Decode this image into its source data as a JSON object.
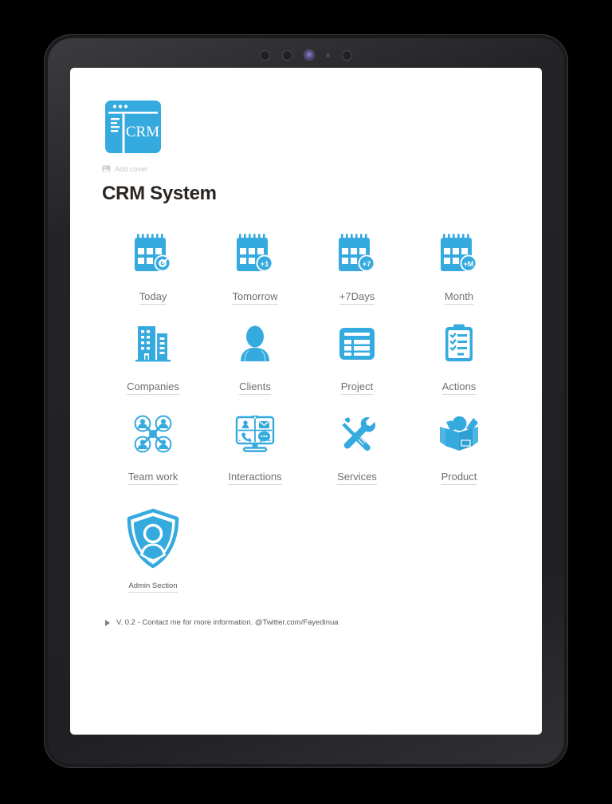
{
  "device": {
    "type": "tablet-mockup",
    "sensors": [
      "sensor-ring",
      "sensor-ring",
      "front-camera",
      "sensor-dot",
      "sensor-ring"
    ]
  },
  "theme": {
    "accent": "#35AADF",
    "accent_dark": "#2E9FD4",
    "page_bg": "#FFFFFF",
    "title_color": "#2A2520",
    "label_color": "#6F6F6F",
    "underline_color": "#D8D8D8",
    "muted_color": "#C6C6C6",
    "bezel_color": "#1B1B1D"
  },
  "header": {
    "logo_icon": "crm-browser-logo-icon",
    "logo_text": "CRM",
    "add_cover_label": "Add cover",
    "add_cover_icon": "image-icon",
    "title": "CRM System"
  },
  "grid": {
    "items": [
      {
        "label": "Today",
        "icon": "calendar-today-icon",
        "badge": "target"
      },
      {
        "label": "Tomorrow",
        "icon": "calendar-plus-one-icon",
        "badge": "+1"
      },
      {
        "label": "+7Days",
        "icon": "calendar-plus-seven-icon",
        "badge": "+7"
      },
      {
        "label": "Month",
        "icon": "calendar-month-icon",
        "badge": "+M"
      },
      {
        "label": "Companies",
        "icon": "office-building-icon",
        "badge": ""
      },
      {
        "label": "Clients",
        "icon": "person-silhouette-icon",
        "badge": ""
      },
      {
        "label": "Project",
        "icon": "table-layout-icon",
        "badge": ""
      },
      {
        "label": "Actions",
        "icon": "clipboard-checklist-icon",
        "badge": ""
      },
      {
        "label": "Team work",
        "icon": "team-network-icon",
        "badge": ""
      },
      {
        "label": "Interactions",
        "icon": "monitor-communication-icon",
        "badge": ""
      },
      {
        "label": "Services",
        "icon": "wrench-screwdriver-icon",
        "badge": ""
      },
      {
        "label": "Product",
        "icon": "open-box-icon",
        "badge": ""
      }
    ],
    "admin": {
      "label": "Admin Section",
      "icon": "shield-person-icon"
    }
  },
  "footer": {
    "toggle_icon": "triangle-right-icon",
    "text": "V. 0.2 - Contact me for more information. @Twitter.com/Fayedinua"
  }
}
